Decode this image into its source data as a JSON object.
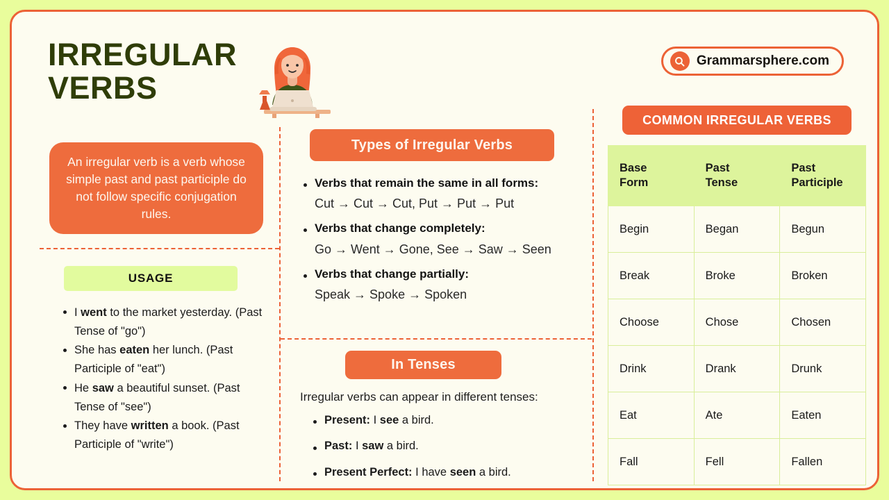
{
  "header": {
    "title": "IRREGULAR VERBS",
    "logo_text": "Grammarsphere.com",
    "logo_icon": "search-icon",
    "illustration_alt": "woman-working-on-laptop-illustration"
  },
  "colors": {
    "page_background": "#e9fd9c",
    "card_background": "#fdfcf0",
    "accent_orange": "#ec6236",
    "accent_green": "#ddf49c",
    "title_green": "#2f3d08"
  },
  "left_column": {
    "definition": "An irregular verb is a verb whose simple past and past participle do not follow specific conjugation rules.",
    "usage_badge": "USAGE",
    "usage_items": [
      {
        "pre": "I ",
        "bold": "went",
        "post": " to the market yesterday. (Past Tense of \"go\")"
      },
      {
        "pre": "She has ",
        "bold": "eaten",
        "post": " her lunch. (Past Participle of \"eat\")"
      },
      {
        "pre": "He ",
        "bold": "saw",
        "post": " a beautiful sunset. (Past Tense of \"see\")"
      },
      {
        "pre": "They have ",
        "bold": "written",
        "post": " a book. (Past Participle of \"write\")"
      }
    ]
  },
  "middle_column": {
    "types_heading": "Types of Irregular Verbs",
    "types": [
      {
        "name": "Verbs that remain the same in all forms:",
        "example": "Cut → Cut → Cut, Put → Put → Put"
      },
      {
        "name": "Verbs that change completely:",
        "example": "Go → Went → Gone, See → Saw → Seen"
      },
      {
        "name": "Verbs that change partially:",
        "example": "Speak → Spoke → Spoken"
      }
    ],
    "tenses_heading": "In Tenses",
    "tenses_intro": "Irregular verbs can appear in different tenses:",
    "tenses_items": [
      {
        "label": "Present:",
        "pre": " I ",
        "bold": "see",
        "post": " a bird."
      },
      {
        "label": "Past:",
        "pre": " I ",
        "bold": "saw",
        "post": " a bird."
      },
      {
        "label": "Present Perfect:",
        "pre": " I have ",
        "bold": "seen",
        "post": " a bird."
      }
    ]
  },
  "right_column": {
    "table_heading": "COMMON IRREGULAR VERBS",
    "table": {
      "headers": [
        {
          "line1": "Base",
          "line2": "Form"
        },
        {
          "line1": "Past",
          "line2": "Tense"
        },
        {
          "line1": "Past",
          "line2": "Participle"
        }
      ],
      "rows": [
        [
          "Begin",
          "Began",
          "Begun"
        ],
        [
          "Break",
          "Broke",
          "Broken"
        ],
        [
          "Choose",
          "Chose",
          "Chosen"
        ],
        [
          "Drink",
          "Drank",
          "Drunk"
        ],
        [
          "Eat",
          "Ate",
          "Eaten"
        ],
        [
          "Fall",
          "Fell",
          "Fallen"
        ]
      ]
    }
  }
}
